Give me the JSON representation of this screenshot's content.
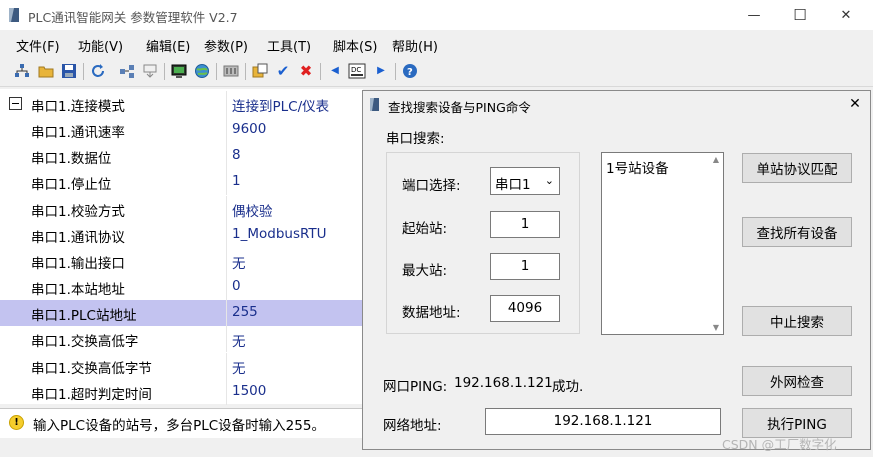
{
  "app": {
    "title": "PLC通讯智能网关 参数管理软件 V2.7",
    "window_controls": {
      "minimize": "—",
      "maximize": "☐",
      "close": "✕"
    }
  },
  "menu": [
    "文件(F)",
    "功能(V)",
    "编辑(E)",
    "参数(P)",
    "工具(T)",
    "脚本(S)",
    "帮助(H)"
  ],
  "toolbar_icons": [
    "network-icon",
    "open-folder-icon",
    "save-icon",
    "refresh-icon",
    "connect-icon",
    "download-icon",
    "monitor-icon",
    "web-icon",
    "device-icon",
    "paste-icon",
    "check-icon",
    "delete-icon",
    "prev-icon",
    "dc-icon",
    "next-icon",
    "help-icon"
  ],
  "grid": {
    "rows": [
      {
        "name": "串口1.连接模式",
        "value": "连接到PLC/仪表"
      },
      {
        "name": "串口1.通讯速率",
        "value": "9600"
      },
      {
        "name": "串口1.数据位",
        "value": "8"
      },
      {
        "name": "串口1.停止位",
        "value": "1"
      },
      {
        "name": "串口1.校验方式",
        "value": "偶校验"
      },
      {
        "name": "串口1.通讯协议",
        "value": "1_ModbusRTU"
      },
      {
        "name": "串口1.输出接口",
        "value": "无"
      },
      {
        "name": "串口1.本站地址",
        "value": "0"
      },
      {
        "name": "串口1.PLC站地址",
        "value": "255"
      },
      {
        "name": "串口1.交换高低字",
        "value": "无"
      },
      {
        "name": "串口1.交换高低字节",
        "value": "无"
      },
      {
        "name": "串口1.超时判定时间",
        "value": "1500"
      }
    ],
    "selected_index": 8
  },
  "status": {
    "text": "输入PLC设备的站号，多台PLC设备时输入255。",
    "icon": "!"
  },
  "dialog": {
    "title": "查找搜索设备与PING命令",
    "close": "✕",
    "serial_search_label": "串口搜索:",
    "port_label": "端口选择:",
    "port_value": "串口1",
    "start_label": "起始站:",
    "start_value": "1",
    "max_label": "最大站:",
    "max_value": "1",
    "data_addr_label": "数据地址:",
    "data_addr_value": "4096",
    "device_list": [
      "1号站设备"
    ],
    "buttons": {
      "match": "单站协议匹配",
      "find_all": "查找所有设备",
      "stop": "中止搜索",
      "wan_check": "外网检查",
      "ping": "执行PING"
    },
    "ping_label": "网口PING:",
    "ping_ip": "192.168.1.121",
    "ping_result": "成功.",
    "net_addr_label": "网络地址:",
    "net_addr_value": "192.168.1.121"
  },
  "watermark": "CSDN @工厂数字化",
  "colors": {
    "value_text": "#1a2f8c",
    "selected_row": "#c3c3f0"
  }
}
